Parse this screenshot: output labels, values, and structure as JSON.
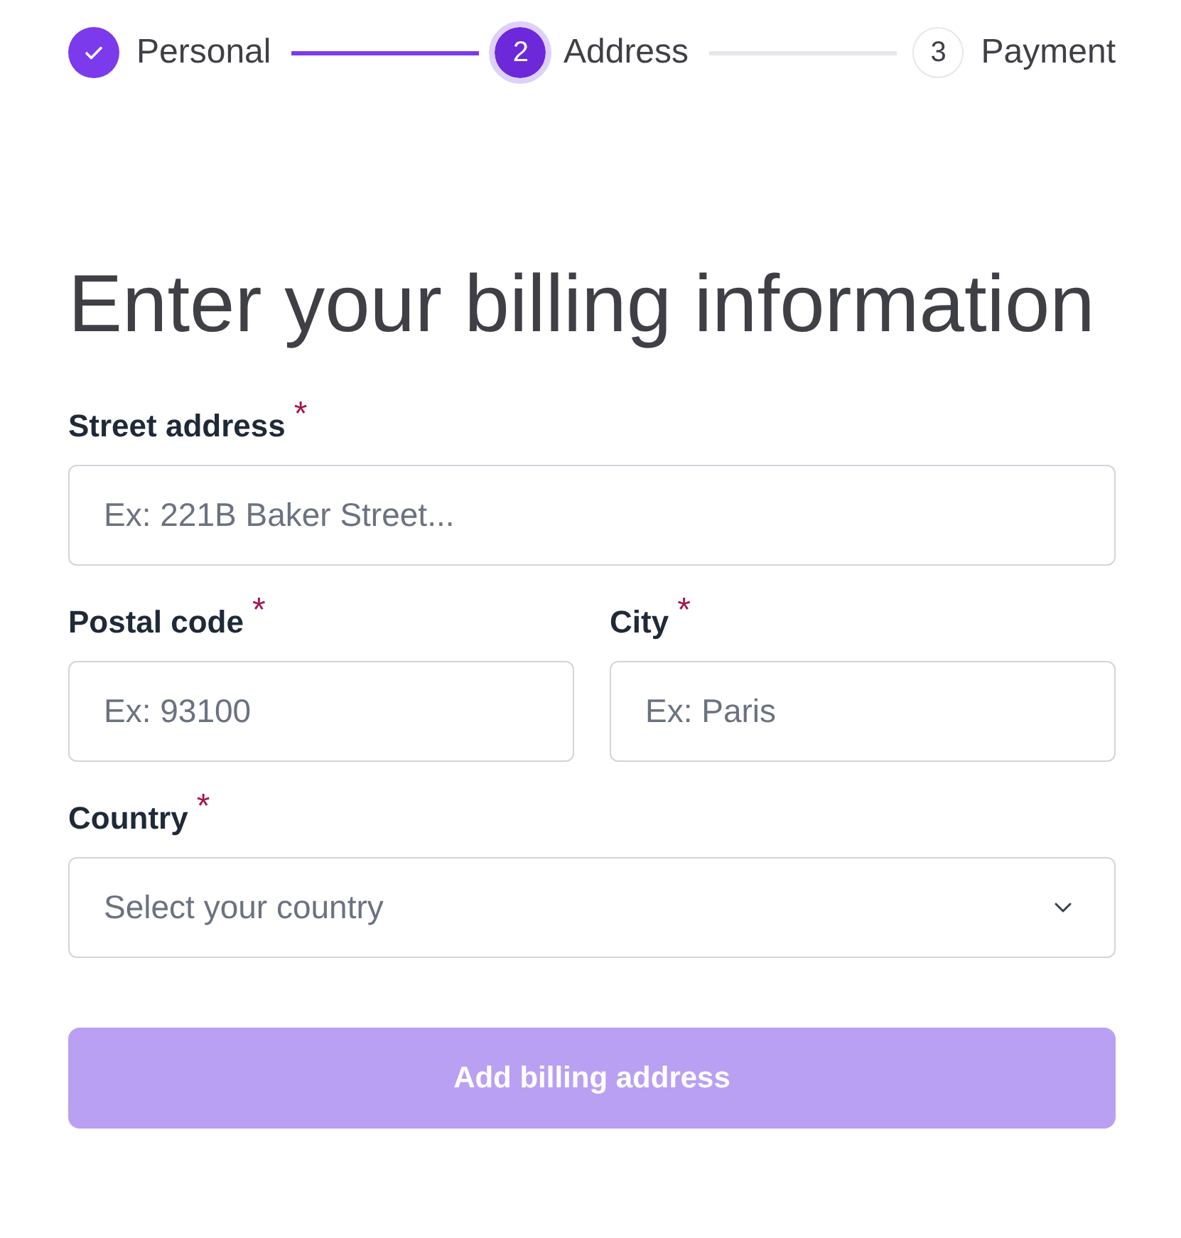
{
  "steps": [
    {
      "label": "Personal",
      "completed": true,
      "selected": false
    },
    {
      "number": "2",
      "label": "Address",
      "completed": false,
      "selected": true
    },
    {
      "number": "3",
      "label": "Payment",
      "completed": false,
      "selected": false
    }
  ],
  "heading": "Enter your billing information",
  "form": {
    "rows": [
      {
        "fields": [
          {
            "kind": "text",
            "label": "Street address",
            "required_mark": "*",
            "placeholder": "Ex: 221B Baker Street..."
          }
        ]
      },
      {
        "fields": [
          {
            "kind": "text",
            "label": "Postal code",
            "required_mark": "*",
            "placeholder": "Ex: 93100"
          },
          {
            "kind": "text",
            "label": "City",
            "required_mark": "*",
            "placeholder": "Ex: Paris"
          }
        ]
      },
      {
        "fields": [
          {
            "kind": "select",
            "label": "Country",
            "required_mark": "*",
            "placeholder": "Select your country"
          }
        ]
      }
    ]
  },
  "submit_button": {
    "label": "Add billing address",
    "disabled": true
  }
}
